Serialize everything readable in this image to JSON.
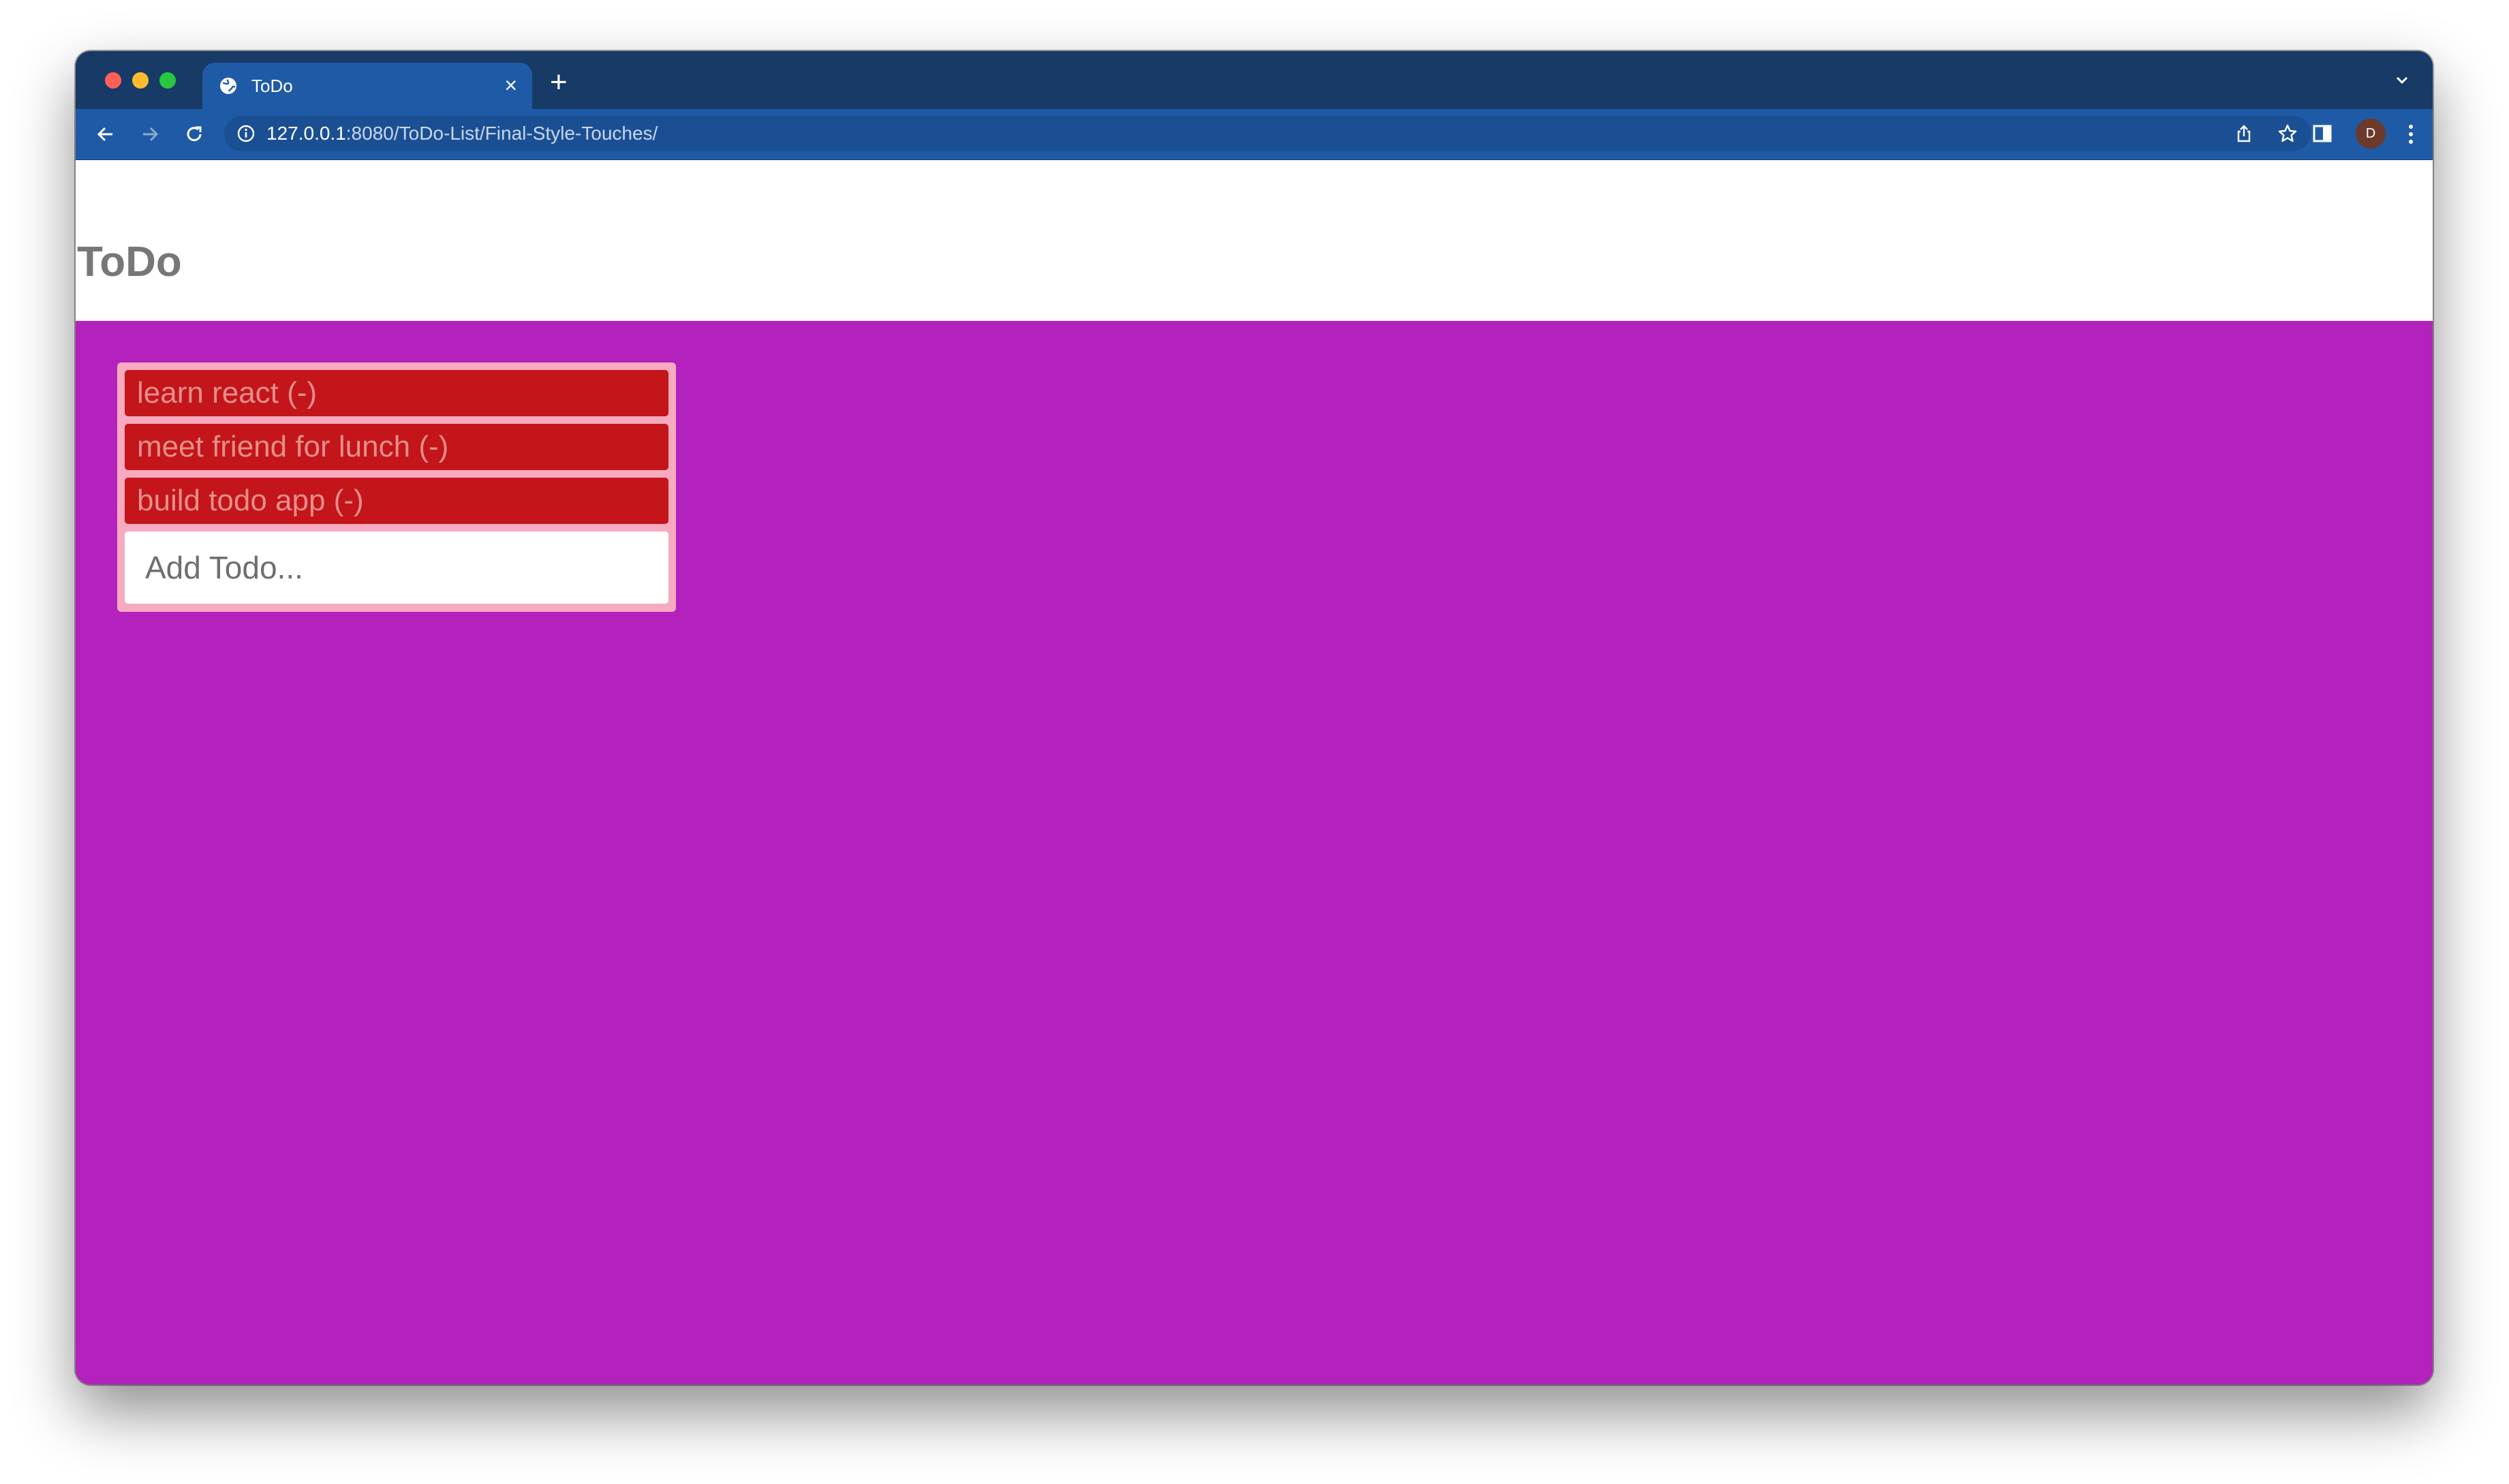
{
  "browser": {
    "tab_title": "ToDo",
    "tab_close": "×",
    "new_tab": "+",
    "url_host": "127.0.0.1",
    "url_rest": ":8080/ToDo-List/Final-Style-Touches/",
    "profile_initial": "D"
  },
  "app": {
    "title": "ToDo",
    "todos": [
      {
        "label": "learn react (-)"
      },
      {
        "label": "meet friend for lunch (-)"
      },
      {
        "label": "build todo app (-)"
      }
    ],
    "add_placeholder": "Add Todo..."
  },
  "colors": {
    "page_background": "#b322bc",
    "todo_item_background": "#c3151a",
    "todo_item_text": "#e58e8a",
    "panel_background": "#f7a9bf",
    "browser_chrome": "#1f5aa6"
  },
  "icons": {
    "back": "arrow-left-icon",
    "forward": "arrow-right-icon",
    "reload": "reload-icon",
    "site_info": "info-icon",
    "share": "share-icon",
    "bookmark": "star-icon",
    "side_panel": "side-panel-icon",
    "menu": "kebab-menu-icon",
    "tab_favicon": "globe-icon",
    "tab_list": "chevron-down-icon"
  }
}
